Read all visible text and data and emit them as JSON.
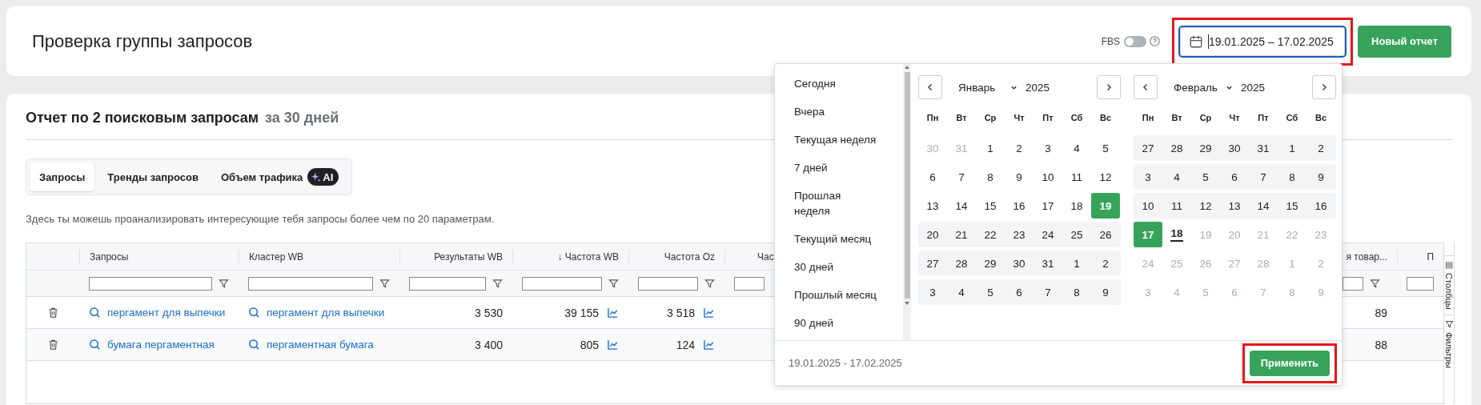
{
  "header": {
    "title": "Проверка группы запросов",
    "fbs": {
      "label": "FBS",
      "on": false
    },
    "date_field": {
      "value": "19.01.2025 – 17.02.2025",
      "focused": true,
      "highlighted": true
    },
    "new_report_button": "Новый отчет"
  },
  "report": {
    "title": "Отчет по 2 поисковым запросам",
    "period": "за 30 дней",
    "tabs": [
      {
        "label": "Запросы",
        "selected": true
      },
      {
        "label": "Тренды запросов",
        "selected": false
      },
      {
        "label": "Объем трафика",
        "selected": false,
        "badge": "AI"
      }
    ],
    "description": "Здесь ты можешь проанализировать интересующие тебя запросы более чем по 20 параметрам.",
    "table": {
      "columns": [
        {
          "label": "Запросы"
        },
        {
          "label": "Кластер WB"
        },
        {
          "label": "Результаты WB"
        },
        {
          "label": "↓ Частота WB"
        },
        {
          "label": "Частота Oz"
        },
        {
          "label": "Час"
        },
        {
          "label": "я товар..."
        },
        {
          "label": "П"
        }
      ],
      "rows": [
        {
          "query": "пергамент для выпечки",
          "cluster": "пергамент для выпечки",
          "results": "3 530",
          "freq_wb": "39 155",
          "freq_oz": "3 518",
          "column_8": "89"
        },
        {
          "query": "бумага пергаментная",
          "cluster": "пергаментная бумага",
          "results": "3 400",
          "freq_wb": "805",
          "freq_oz": "124",
          "column_8": "88"
        }
      ]
    },
    "side_tabs": [
      "Столбцы",
      "Фильтры"
    ]
  },
  "date_picker": {
    "presets": [
      {
        "label": "Сегодня",
        "selected": false
      },
      {
        "label": "Вчера",
        "selected": false
      },
      {
        "label": "Текущая неделя",
        "selected": false
      },
      {
        "label": "7 дней",
        "selected": false
      },
      {
        "label": "Прошлая неделя",
        "selected": false
      },
      {
        "label": "Текущий месяц",
        "selected": false
      },
      {
        "label": "30 дней",
        "selected": false
      },
      {
        "label": "Прошлый месяц",
        "selected": false
      },
      {
        "label": "90 дней",
        "selected": false
      }
    ],
    "months": [
      {
        "month": "Январь",
        "year": "2025",
        "weekdays": [
          "Пн",
          "Вт",
          "Ср",
          "Чт",
          "Пт",
          "Сб",
          "Вс"
        ],
        "weeks": [
          {
            "in_range": false,
            "days": [
              {
                "d": "30",
                "muted": true,
                "selected": false,
                "today": false
              },
              {
                "d": "31",
                "muted": true,
                "selected": false,
                "today": false
              },
              {
                "d": "1",
                "muted": false,
                "selected": false,
                "today": false
              },
              {
                "d": "2",
                "muted": false,
                "selected": false,
                "today": false
              },
              {
                "d": "3",
                "muted": false,
                "selected": false,
                "today": false
              },
              {
                "d": "4",
                "muted": false,
                "selected": false,
                "today": false
              },
              {
                "d": "5",
                "muted": false,
                "selected": false,
                "today": false
              }
            ]
          },
          {
            "in_range": false,
            "days": [
              {
                "d": "6",
                "muted": false,
                "selected": false,
                "today": false
              },
              {
                "d": "7",
                "muted": false,
                "selected": false,
                "today": false
              },
              {
                "d": "8",
                "muted": false,
                "selected": false,
                "today": false
              },
              {
                "d": "9",
                "muted": false,
                "selected": false,
                "today": false
              },
              {
                "d": "10",
                "muted": false,
                "selected": false,
                "today": false
              },
              {
                "d": "11",
                "muted": false,
                "selected": false,
                "today": false
              },
              {
                "d": "12",
                "muted": false,
                "selected": false,
                "today": false
              }
            ]
          },
          {
            "in_range": false,
            "days": [
              {
                "d": "13",
                "muted": false,
                "selected": false,
                "today": false
              },
              {
                "d": "14",
                "muted": false,
                "selected": false,
                "today": false
              },
              {
                "d": "15",
                "muted": false,
                "selected": false,
                "today": false
              },
              {
                "d": "16",
                "muted": false,
                "selected": false,
                "today": false
              },
              {
                "d": "17",
                "muted": false,
                "selected": false,
                "today": false
              },
              {
                "d": "18",
                "muted": false,
                "selected": false,
                "today": false
              },
              {
                "d": "19",
                "muted": false,
                "selected": true,
                "today": false
              }
            ]
          },
          {
            "in_range": true,
            "days": [
              {
                "d": "20",
                "muted": false,
                "selected": false,
                "today": false
              },
              {
                "d": "21",
                "muted": false,
                "selected": false,
                "today": false
              },
              {
                "d": "22",
                "muted": false,
                "selected": false,
                "today": false
              },
              {
                "d": "23",
                "muted": false,
                "selected": false,
                "today": false
              },
              {
                "d": "24",
                "muted": false,
                "selected": false,
                "today": false
              },
              {
                "d": "25",
                "muted": false,
                "selected": false,
                "today": false
              },
              {
                "d": "26",
                "muted": false,
                "selected": false,
                "today": false
              }
            ]
          },
          {
            "in_range": true,
            "days": [
              {
                "d": "27",
                "muted": false,
                "selected": false,
                "today": false
              },
              {
                "d": "28",
                "muted": false,
                "selected": false,
                "today": false
              },
              {
                "d": "29",
                "muted": false,
                "selected": false,
                "today": false
              },
              {
                "d": "30",
                "muted": false,
                "selected": false,
                "today": false
              },
              {
                "d": "31",
                "muted": false,
                "selected": false,
                "today": false
              },
              {
                "d": "1",
                "muted": false,
                "selected": false,
                "today": false
              },
              {
                "d": "2",
                "muted": false,
                "selected": false,
                "today": false
              }
            ]
          },
          {
            "in_range": true,
            "days": [
              {
                "d": "3",
                "muted": false,
                "selected": false,
                "today": false
              },
              {
                "d": "4",
                "muted": false,
                "selected": false,
                "today": false
              },
              {
                "d": "5",
                "muted": false,
                "selected": false,
                "today": false
              },
              {
                "d": "6",
                "muted": false,
                "selected": false,
                "today": false
              },
              {
                "d": "7",
                "muted": false,
                "selected": false,
                "today": false
              },
              {
                "d": "8",
                "muted": false,
                "selected": false,
                "today": false
              },
              {
                "d": "9",
                "muted": false,
                "selected": false,
                "today": false
              }
            ]
          }
        ]
      },
      {
        "month": "Февраль",
        "year": "2025",
        "weekdays": [
          "Пн",
          "Вт",
          "Ср",
          "Чт",
          "Пт",
          "Сб",
          "Вс"
        ],
        "weeks": [
          {
            "in_range": true,
            "days": [
              {
                "d": "27",
                "muted": false,
                "selected": false,
                "today": false
              },
              {
                "d": "28",
                "muted": false,
                "selected": false,
                "today": false
              },
              {
                "d": "29",
                "muted": false,
                "selected": false,
                "today": false
              },
              {
                "d": "30",
                "muted": false,
                "selected": false,
                "today": false
              },
              {
                "d": "31",
                "muted": false,
                "selected": false,
                "today": false
              },
              {
                "d": "1",
                "muted": false,
                "selected": false,
                "today": false
              },
              {
                "d": "2",
                "muted": false,
                "selected": false,
                "today": false
              }
            ]
          },
          {
            "in_range": true,
            "days": [
              {
                "d": "3",
                "muted": false,
                "selected": false,
                "today": false
              },
              {
                "d": "4",
                "muted": false,
                "selected": false,
                "today": false
              },
              {
                "d": "5",
                "muted": false,
                "selected": false,
                "today": false
              },
              {
                "d": "6",
                "muted": false,
                "selected": false,
                "today": false
              },
              {
                "d": "7",
                "muted": false,
                "selected": false,
                "today": false
              },
              {
                "d": "8",
                "muted": false,
                "selected": false,
                "today": false
              },
              {
                "d": "9",
                "muted": false,
                "selected": false,
                "today": false
              }
            ]
          },
          {
            "in_range": true,
            "days": [
              {
                "d": "10",
                "muted": false,
                "selected": false,
                "today": false
              },
              {
                "d": "11",
                "muted": false,
                "selected": false,
                "today": false
              },
              {
                "d": "12",
                "muted": false,
                "selected": false,
                "today": false
              },
              {
                "d": "13",
                "muted": false,
                "selected": false,
                "today": false
              },
              {
                "d": "14",
                "muted": false,
                "selected": false,
                "today": false
              },
              {
                "d": "15",
                "muted": false,
                "selected": false,
                "today": false
              },
              {
                "d": "16",
                "muted": false,
                "selected": false,
                "today": false
              }
            ]
          },
          {
            "in_range": false,
            "days": [
              {
                "d": "17",
                "muted": false,
                "selected": true,
                "today": false
              },
              {
                "d": "18",
                "muted": false,
                "selected": false,
                "today": true
              },
              {
                "d": "19",
                "muted": true,
                "selected": false,
                "today": false
              },
              {
                "d": "20",
                "muted": true,
                "selected": false,
                "today": false
              },
              {
                "d": "21",
                "muted": true,
                "selected": false,
                "today": false
              },
              {
                "d": "22",
                "muted": true,
                "selected": false,
                "today": false
              },
              {
                "d": "23",
                "muted": true,
                "selected": false,
                "today": false
              }
            ]
          },
          {
            "in_range": false,
            "days": [
              {
                "d": "24",
                "muted": true,
                "selected": false,
                "today": false
              },
              {
                "d": "25",
                "muted": true,
                "selected": false,
                "today": false
              },
              {
                "d": "26",
                "muted": true,
                "selected": false,
                "today": false
              },
              {
                "d": "27",
                "muted": true,
                "selected": false,
                "today": false
              },
              {
                "d": "28",
                "muted": true,
                "selected": false,
                "today": false
              },
              {
                "d": "1",
                "muted": true,
                "selected": false,
                "today": false
              },
              {
                "d": "2",
                "muted": true,
                "selected": false,
                "today": false
              }
            ]
          },
          {
            "in_range": false,
            "days": [
              {
                "d": "3",
                "muted": true,
                "selected": false,
                "today": false
              },
              {
                "d": "4",
                "muted": true,
                "selected": false,
                "today": false
              },
              {
                "d": "5",
                "muted": true,
                "selected": false,
                "today": false
              },
              {
                "d": "6",
                "muted": true,
                "selected": false,
                "today": false
              },
              {
                "d": "7",
                "muted": true,
                "selected": false,
                "today": false
              },
              {
                "d": "8",
                "muted": true,
                "selected": false,
                "today": false
              },
              {
                "d": "9",
                "muted": true,
                "selected": false,
                "today": false
              }
            ]
          }
        ]
      }
    ],
    "range_text": "19.01.2025 - 17.02.2025",
    "apply_button": {
      "label": "Применить",
      "highlighted": true
    }
  }
}
